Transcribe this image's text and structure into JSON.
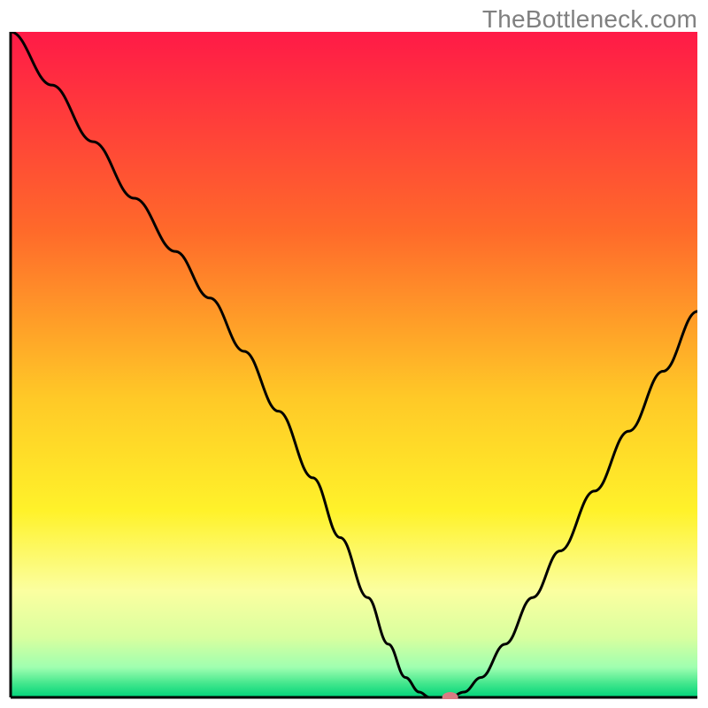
{
  "watermark": "TheBottleneck.com",
  "chart_data": {
    "type": "line",
    "title": "",
    "xlabel": "",
    "ylabel": "",
    "xlim": [
      0,
      100
    ],
    "ylim": [
      0,
      100
    ],
    "gradient_stops": [
      {
        "offset": 0.0,
        "color": "#ff1a47"
      },
      {
        "offset": 0.3,
        "color": "#ff6a2a"
      },
      {
        "offset": 0.55,
        "color": "#ffc927"
      },
      {
        "offset": 0.72,
        "color": "#fff22a"
      },
      {
        "offset": 0.84,
        "color": "#fbffa0"
      },
      {
        "offset": 0.91,
        "color": "#d9ff9f"
      },
      {
        "offset": 0.955,
        "color": "#9fffb0"
      },
      {
        "offset": 0.98,
        "color": "#40e68c"
      },
      {
        "offset": 1.0,
        "color": "#00d37a"
      }
    ],
    "curve": [
      {
        "x": 0.0,
        "y": 100.0
      },
      {
        "x": 6.0,
        "y": 92.0
      },
      {
        "x": 12.0,
        "y": 83.5
      },
      {
        "x": 18.0,
        "y": 75.0
      },
      {
        "x": 24.0,
        "y": 67.0
      },
      {
        "x": 29.0,
        "y": 60.0
      },
      {
        "x": 34.0,
        "y": 52.0
      },
      {
        "x": 39.0,
        "y": 43.0
      },
      {
        "x": 44.0,
        "y": 33.0
      },
      {
        "x": 48.0,
        "y": 24.0
      },
      {
        "x": 52.0,
        "y": 15.0
      },
      {
        "x": 55.0,
        "y": 8.0
      },
      {
        "x": 57.5,
        "y": 3.0
      },
      {
        "x": 59.5,
        "y": 0.8
      },
      {
        "x": 61.0,
        "y": 0.0
      },
      {
        "x": 64.0,
        "y": 0.0
      },
      {
        "x": 66.0,
        "y": 0.8
      },
      {
        "x": 68.5,
        "y": 3.0
      },
      {
        "x": 72.0,
        "y": 8.0
      },
      {
        "x": 76.0,
        "y": 15.0
      },
      {
        "x": 80.0,
        "y": 22.0
      },
      {
        "x": 85.0,
        "y": 31.0
      },
      {
        "x": 90.0,
        "y": 40.0
      },
      {
        "x": 95.0,
        "y": 49.0
      },
      {
        "x": 100.0,
        "y": 58.0
      }
    ],
    "marker": {
      "x": 64.0,
      "y": 0.0,
      "rx": 9,
      "ry": 6,
      "color": "#d97b83"
    },
    "axes": {
      "x": {
        "y": 0,
        "x1": 0,
        "x2": 100
      },
      "y": {
        "x": 0,
        "y1": 0,
        "y2": 100
      }
    }
  }
}
